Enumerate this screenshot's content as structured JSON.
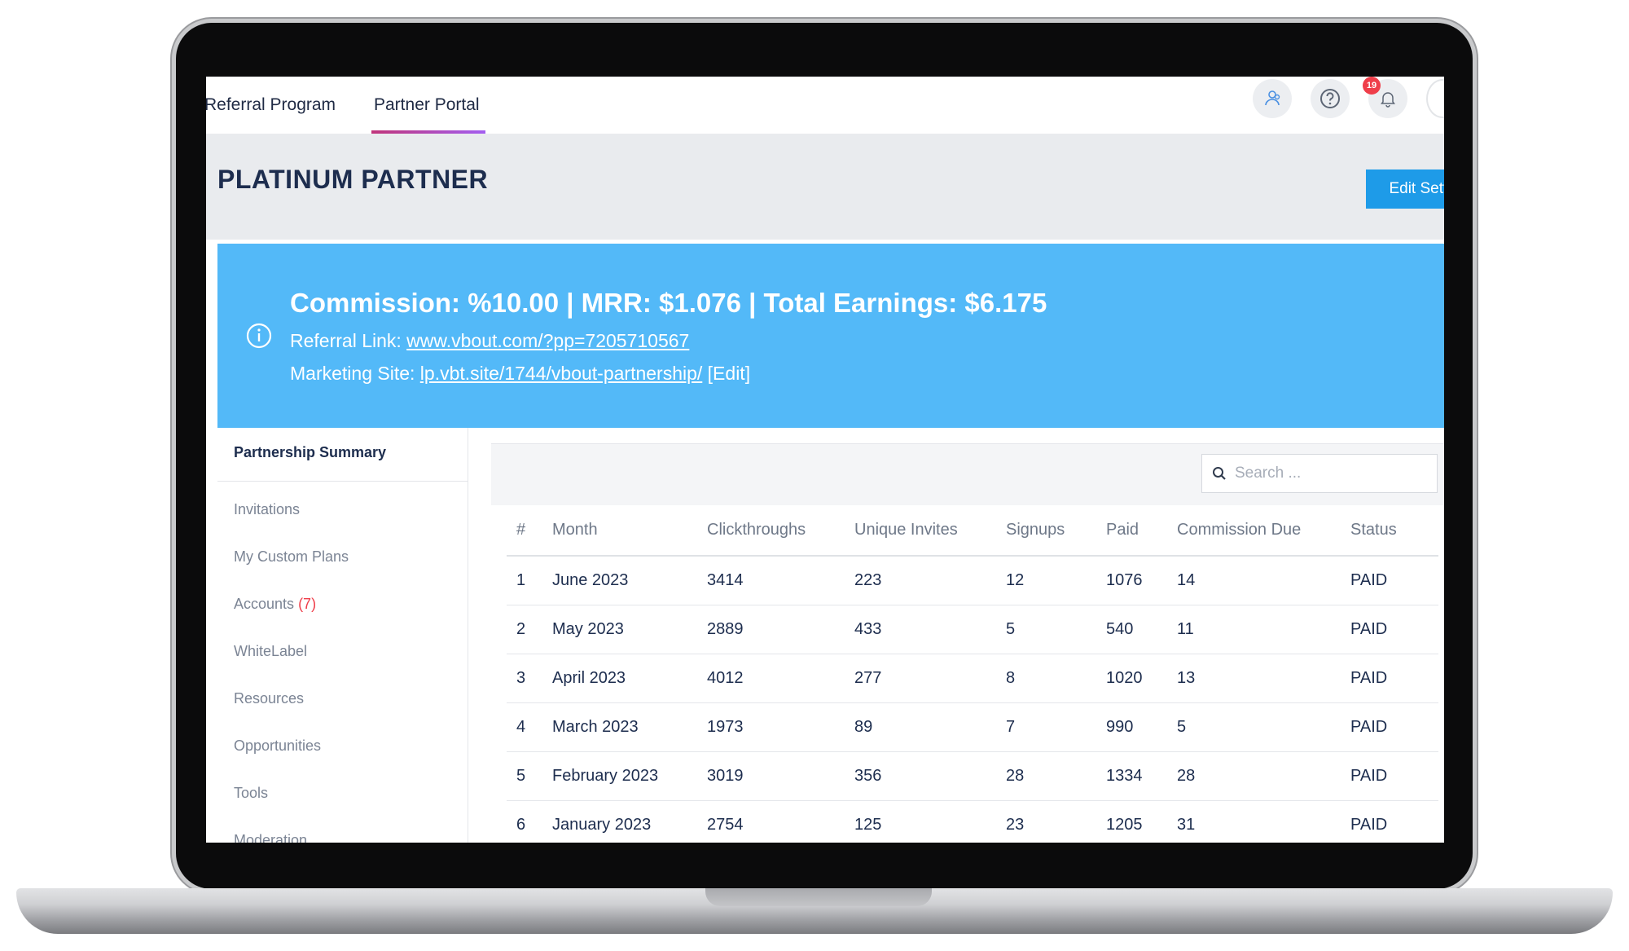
{
  "nav": {
    "tabs": [
      {
        "label": "Referral Program",
        "active": false
      },
      {
        "label": "Partner Portal",
        "active": true
      }
    ],
    "icons": [
      "users-icon",
      "help-icon",
      "bell-icon",
      "avatar"
    ],
    "notification_count": "19"
  },
  "header": {
    "title": "PLATINUM PARTNER",
    "edit_settings_label": "Edit Setti"
  },
  "banner": {
    "headline": "Commission: %10.00 | MRR: $1.076 | Total Earnings: $6.175",
    "referral_label": "Referral Link: ",
    "referral_link": "www.vbout.com/?pp=7205710567",
    "marketing_label": "Marketing Site: ",
    "marketing_link": "lp.vbt.site/1744/vbout-partnership/",
    "marketing_edit": "[Edit]"
  },
  "sidebar": {
    "active": "Partnership Summary",
    "items": [
      {
        "label": "Invitations"
      },
      {
        "label": "My Custom Plans"
      },
      {
        "label": "Accounts",
        "count": "(7)"
      },
      {
        "label": "WhiteLabel"
      },
      {
        "label": "Resources"
      },
      {
        "label": "Opportunities"
      },
      {
        "label": "Tools"
      },
      {
        "label": "Moderation"
      }
    ]
  },
  "search": {
    "placeholder": "Search ..."
  },
  "table": {
    "headers": [
      "#",
      "Month",
      "Clickthroughs",
      "Unique Invites",
      "Signups",
      "Paid",
      "Commission Due",
      "Status"
    ],
    "rows": [
      [
        "1",
        "June 2023",
        "3414",
        "223",
        "12",
        "1076",
        "14",
        "PAID"
      ],
      [
        "2",
        "May 2023",
        "2889",
        "433",
        "5",
        "540",
        "11",
        "PAID"
      ],
      [
        "3",
        "April 2023",
        "4012",
        "277",
        "8",
        "1020",
        "13",
        "PAID"
      ],
      [
        "4",
        "March 2023",
        "1973",
        "89",
        "7",
        "990",
        "5",
        "PAID"
      ],
      [
        "5",
        "February 2023",
        "3019",
        "356",
        "28",
        "1334",
        "28",
        "PAID"
      ],
      [
        "6",
        "January 2023",
        "2754",
        "125",
        "23",
        "1205",
        "31",
        "PAID"
      ]
    ]
  },
  "colors": {
    "banner": "#53b9f8",
    "accent": "#1e9be8",
    "badge": "#ef3e4a",
    "title": "#1d2d4e"
  }
}
